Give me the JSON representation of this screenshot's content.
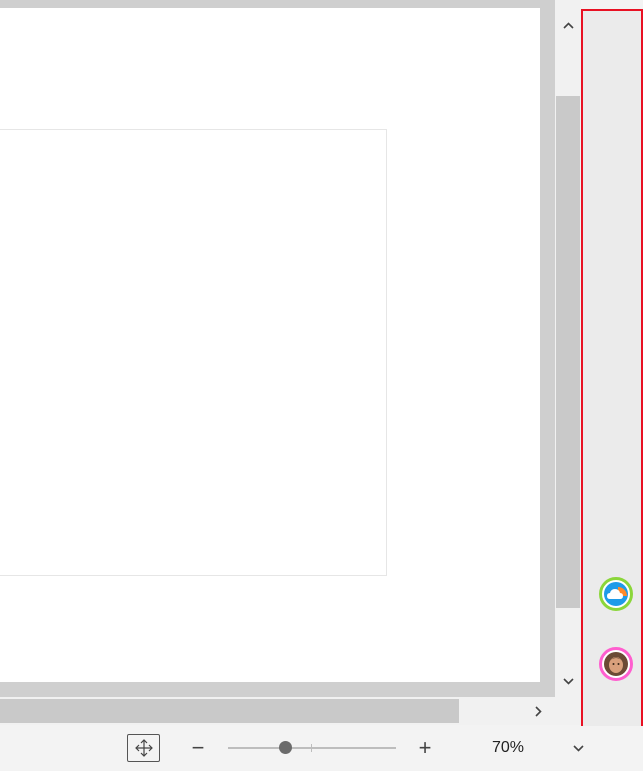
{
  "statusbar": {
    "zoom_level": "70%",
    "zoom_percent": 70,
    "zoom_minus_label": "−",
    "zoom_plus_label": "+"
  },
  "side_panel": {
    "border_color": "#e81123",
    "avatars": [
      {
        "name": "cloud-app-avatar",
        "ring_color": "#8bd63a"
      },
      {
        "name": "user-avatar",
        "ring_color": "#ff5ecf"
      }
    ]
  },
  "icons": {
    "scroll_up": "chevron-up-icon",
    "scroll_down": "chevron-down-icon",
    "scroll_right": "chevron-right-icon",
    "fit": "fit-to-window-icon",
    "zoom_dropdown": "chevron-down-icon"
  }
}
